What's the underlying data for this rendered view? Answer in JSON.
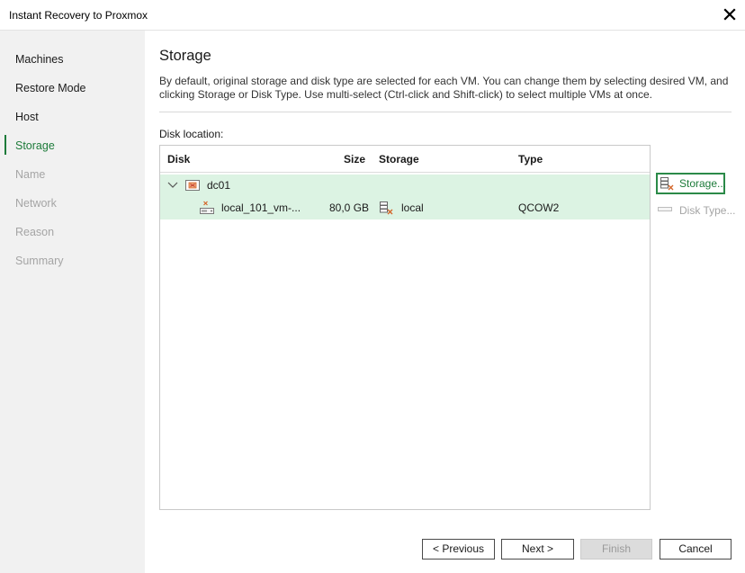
{
  "window": {
    "title": "Instant Recovery to Proxmox"
  },
  "sidebar": {
    "items": [
      {
        "label": "Machines",
        "state": "done"
      },
      {
        "label": "Restore Mode",
        "state": "done"
      },
      {
        "label": "Host",
        "state": "done"
      },
      {
        "label": "Storage",
        "state": "active"
      },
      {
        "label": "Name",
        "state": "disabled"
      },
      {
        "label": "Network",
        "state": "disabled"
      },
      {
        "label": "Reason",
        "state": "disabled"
      },
      {
        "label": "Summary",
        "state": "disabled"
      }
    ]
  },
  "page": {
    "title": "Storage",
    "description": "By default, original storage and disk type are selected for each VM. You can change them by selecting desired VM, and clicking Storage or Disk Type. Use multi-select (Ctrl-click and Shift-click) to select multiple VMs at once.",
    "disk_location_label": "Disk location:"
  },
  "grid": {
    "columns": {
      "disk": "Disk",
      "size": "Size",
      "storage": "Storage",
      "type": "Type"
    },
    "vm": {
      "name": "dc01",
      "icon": "vm-icon",
      "expanded": true
    },
    "disk_row": {
      "disk": "local_101_vm-...",
      "size": "80,0 GB",
      "storage": "local",
      "type": "QCOW2",
      "icon": "disk-icon",
      "storage_icon": "datastore-icon"
    }
  },
  "actions": {
    "storage_label": "Storage...",
    "disk_type_label": "Disk Type..."
  },
  "footer": {
    "previous": "< Previous",
    "next": "Next >",
    "finish": "Finish",
    "cancel": "Cancel"
  },
  "colors": {
    "accent": "#1d7b3a",
    "selection": "#dcf3e3",
    "sidebar_bg": "#f1f1f1"
  }
}
